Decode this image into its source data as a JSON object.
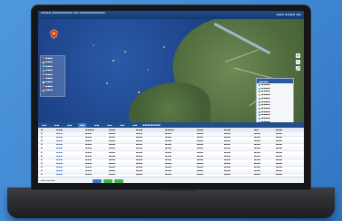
{
  "colors": {
    "background": "#4a8fd6",
    "topbar": "#143b70",
    "map_water": "#16377a",
    "land": "#4f6b3d",
    "tab_active": "#3b77c4",
    "link": "#2a6ad0",
    "accent_green": "#3cb44b"
  },
  "icons": {
    "logo": "emblem-icon",
    "zoom_in": "plus-icon",
    "zoom_out": "minus-icon",
    "fullscreen": "expand-icon"
  },
  "layers": [
    {
      "color": "#ff4d4d"
    },
    {
      "color": "#ffd24d"
    },
    {
      "color": "#4dff88"
    },
    {
      "color": "#4dd2ff"
    },
    {
      "color": "#ff9e4d"
    },
    {
      "color": "#c44dff"
    },
    {
      "color": "#ffffff"
    },
    {
      "color": "#ff4da6"
    },
    {
      "color": "#9eff4d"
    }
  ],
  "legend_items": [
    {
      "color": "#2ea043"
    },
    {
      "color": "#2ea043"
    },
    {
      "color": "#2ea043"
    },
    {
      "color": "#e0a000"
    },
    {
      "color": "#2ea043"
    },
    {
      "color": "#d93030"
    },
    {
      "color": "#2ea043"
    },
    {
      "color": "#2ea043"
    },
    {
      "color": "#2a6ad0"
    },
    {
      "color": "#2ea043"
    },
    {
      "color": "#2ea043"
    },
    {
      "color": "#2ea043"
    }
  ],
  "tabs": [
    {
      "active": false
    },
    {
      "active": false
    },
    {
      "active": false
    },
    {
      "active": true
    },
    {
      "active": false
    },
    {
      "active": false
    },
    {
      "active": false
    },
    {
      "active": false
    }
  ],
  "table": {
    "row_count": 12
  },
  "pager": {
    "buttons": [
      {
        "color": "#3b77c4"
      },
      {
        "color": "#3cb44b"
      },
      {
        "color": "#3cb44b"
      }
    ]
  }
}
